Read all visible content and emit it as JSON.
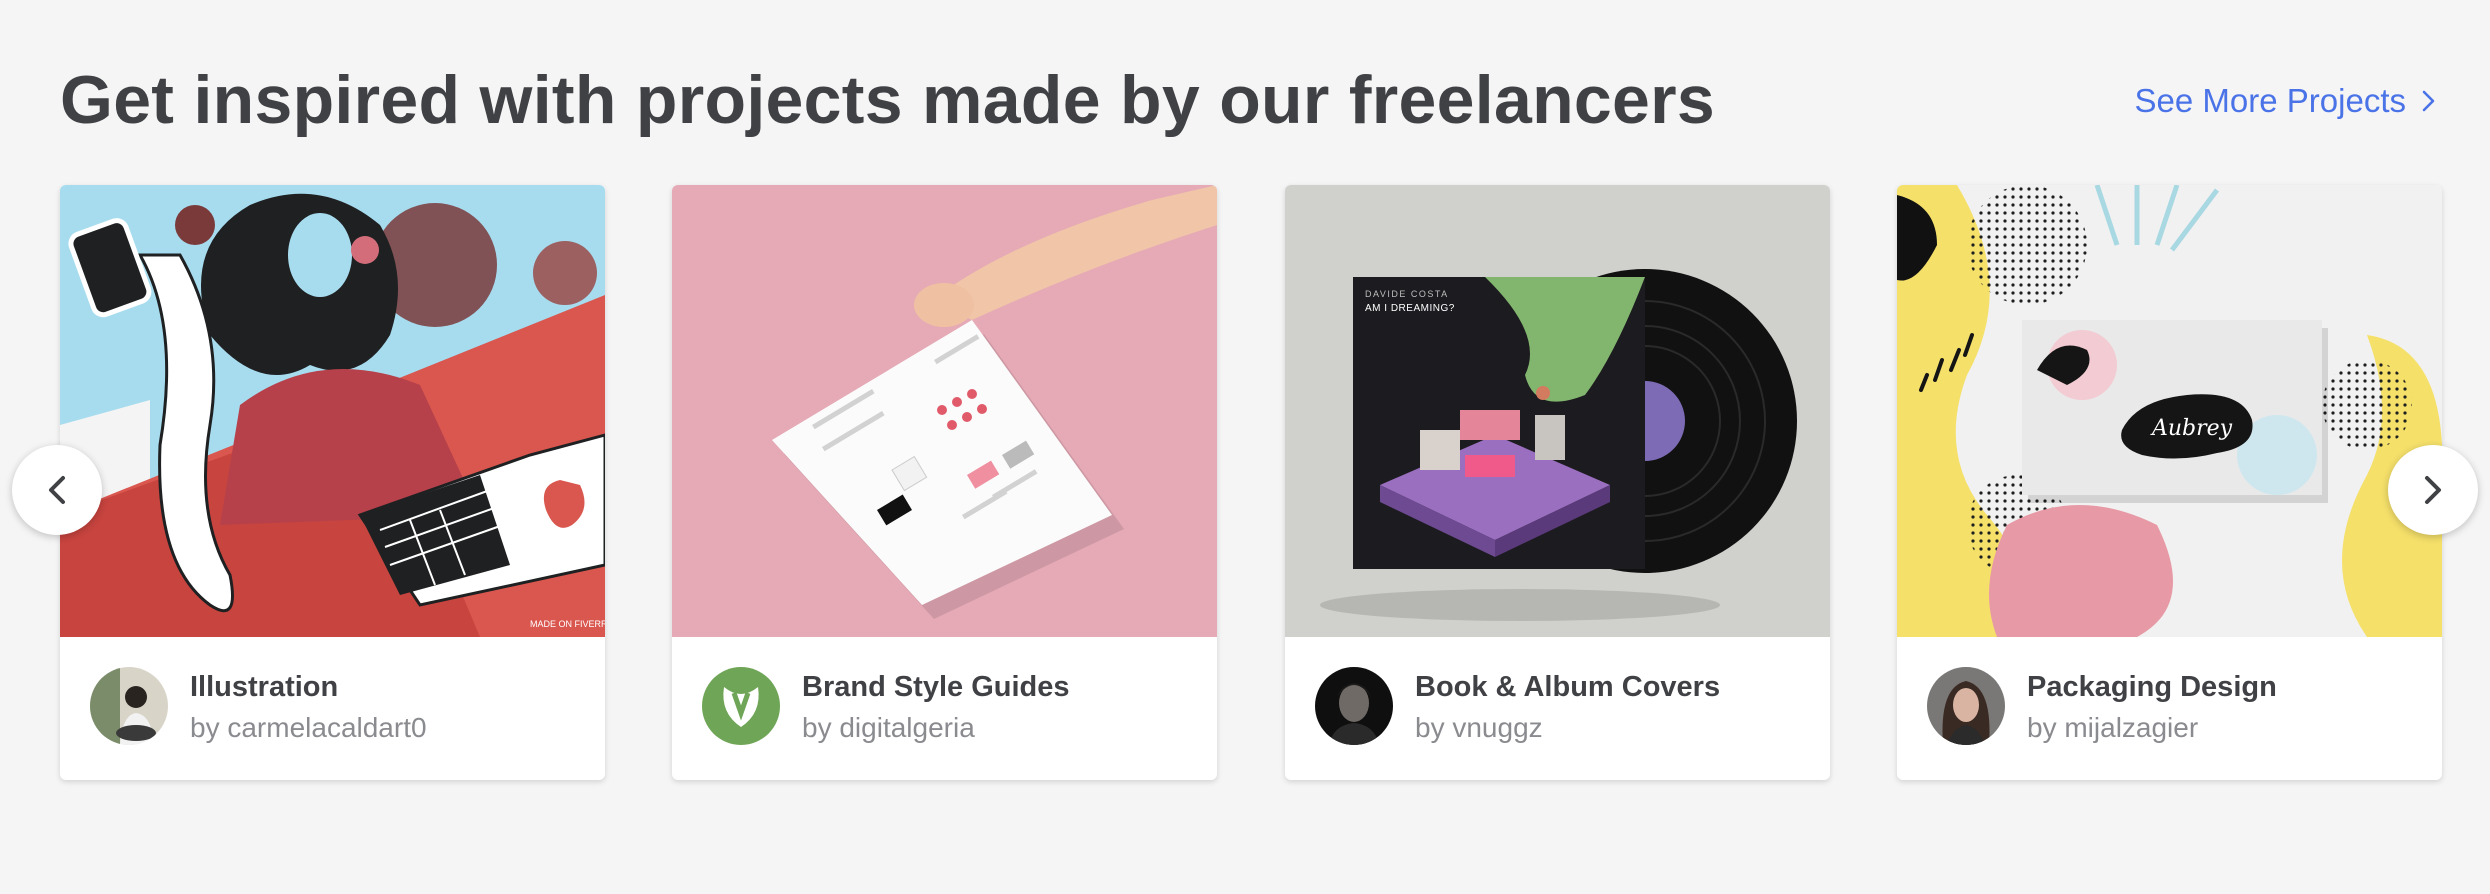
{
  "section": {
    "title": "Get inspired with projects made by our freelancers",
    "see_more_label": "See More Projects"
  },
  "cards": [
    {
      "category": "Illustration",
      "author": "by carmelacaldart0",
      "watermark": "MADE ON FIVERR"
    },
    {
      "category": "Brand Style Guides",
      "author": "by digitalgeria"
    },
    {
      "category": "Book & Album Covers",
      "author": "by vnuggz",
      "album_artist": "DAVIDE COSTA",
      "album_title": "AM I DREAMING?"
    },
    {
      "category": "Packaging Design",
      "author": "by mijalzagier",
      "package_text": "Aubrey"
    }
  ],
  "icons": {
    "prev": "chevron-left-icon",
    "next": "chevron-right-icon",
    "see_more": "chevron-right-icon"
  },
  "colors": {
    "heading": "#404145",
    "link": "#4a73e8",
    "muted": "#8a8b8f",
    "background": "#f5f5f5"
  }
}
